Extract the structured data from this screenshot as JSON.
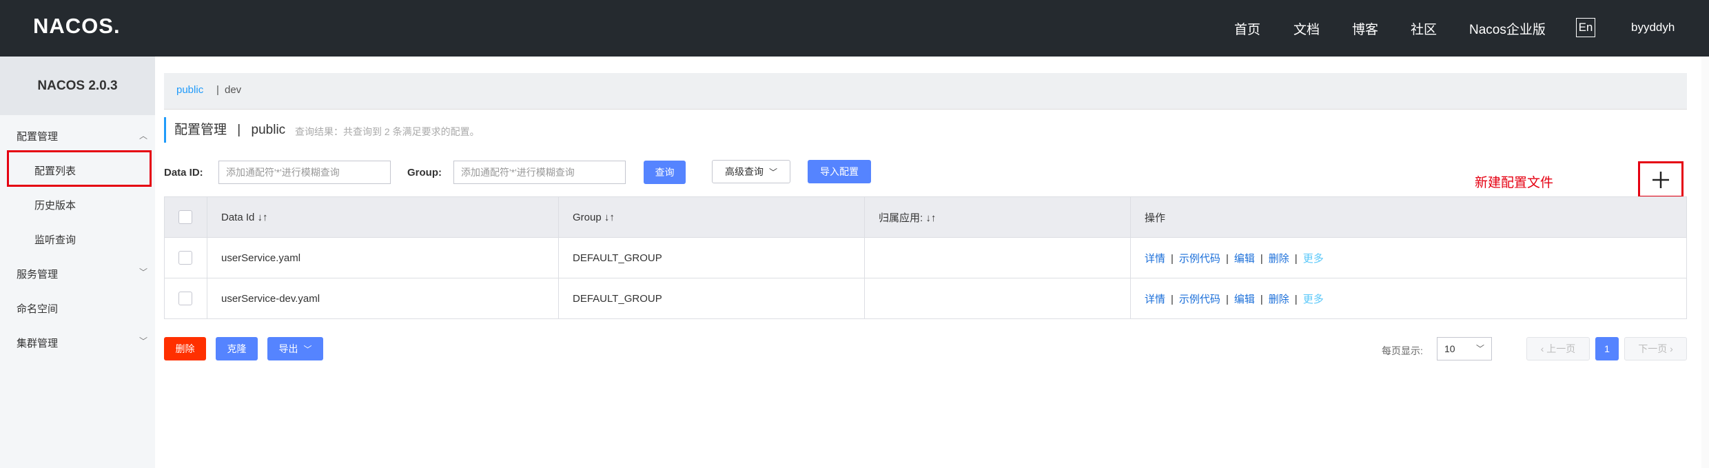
{
  "header": {
    "logo": "NACOS.",
    "nav": [
      "首页",
      "文档",
      "博客",
      "社区",
      "Nacos企业版"
    ],
    "lang": "En",
    "user": "byyddyh"
  },
  "sidebar": {
    "version": "NACOS 2.0.3",
    "items": [
      {
        "label": "配置管理"
      },
      {
        "label": "配置列表"
      },
      {
        "label": "历史版本"
      },
      {
        "label": "监听查询"
      },
      {
        "label": "服务管理"
      },
      {
        "label": "命名空间"
      },
      {
        "label": "集群管理"
      }
    ]
  },
  "breadcrumb": {
    "active": "public",
    "sep": "|",
    "other": "dev"
  },
  "page": {
    "title_main": "配置管理",
    "title_sep": "|",
    "title_ns": "public",
    "result": "查询结果：共查询到 2 条满足要求的配置。"
  },
  "search": {
    "dataid_label": "Data ID:",
    "dataid_placeholder": "添加通配符'*'进行模糊查询",
    "group_label": "Group:",
    "group_placeholder": "添加通配符'*'进行模糊查询",
    "query_btn": "查询",
    "advanced_btn": "高级查询",
    "import_btn": "导入配置"
  },
  "annotation": {
    "text": "新建配置文件",
    "color": "#e50012"
  },
  "table": {
    "headers": [
      "Data Id",
      "Group",
      "归属应用:",
      "操作"
    ],
    "rows": [
      {
        "dataid": "userService.yaml",
        "group": "DEFAULT_GROUP",
        "app": ""
      },
      {
        "dataid": "userService-dev.yaml",
        "group": "DEFAULT_GROUP",
        "app": ""
      }
    ],
    "ops": [
      "详情",
      "示例代码",
      "编辑",
      "删除",
      "更多"
    ],
    "op_sep": "|"
  },
  "footer": {
    "delete_btn": "删除",
    "clone_btn": "克隆",
    "export_btn": "导出",
    "pagesize_label": "每页显示:",
    "pagesize_value": "10",
    "prev": "上一页",
    "page": "1",
    "next": "下一页"
  },
  "colors": {
    "topbar": "#252a2f",
    "primary": "#5584ff",
    "danger": "#ff3000",
    "link": "#1b6fd9"
  }
}
